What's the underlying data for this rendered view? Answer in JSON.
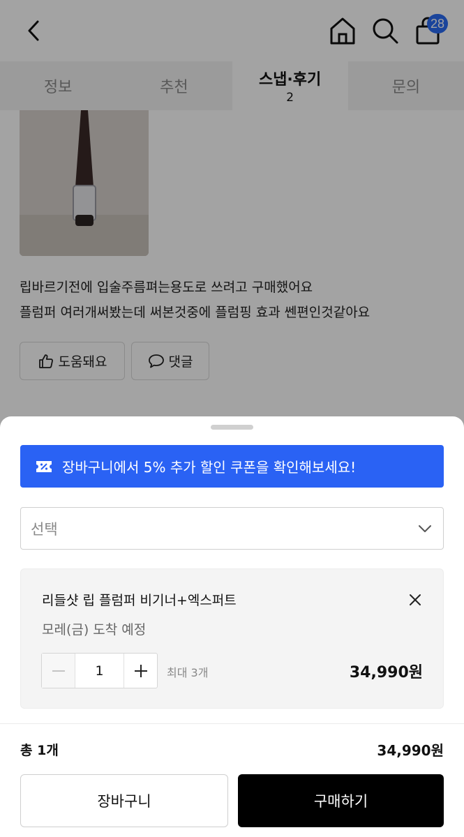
{
  "header": {
    "cart_count": "28"
  },
  "tabs": [
    {
      "label": "정보",
      "count": ""
    },
    {
      "label": "추천",
      "count": ""
    },
    {
      "label": "스냅·후기",
      "count": "2"
    },
    {
      "label": "문의",
      "count": ""
    }
  ],
  "review": {
    "line1": "립바르기전에 입술주름펴는용도로 쓰려고 구매했어요",
    "line2": "플럼퍼 여러개써봤는데 써본것중에 플럼핑 효과 쎈편인것같아요",
    "helpful_label": "도움돼요",
    "comment_label": "댓글"
  },
  "sheet": {
    "coupon_text": "장바구니에서 5% 추가 할인 쿠폰을 확인해보세요!",
    "select_placeholder": "선택",
    "option": {
      "title": "리들샷 립 플럼퍼 비기너+엑스퍼트",
      "delivery": "모레(금) 도착 예정",
      "quantity": "1",
      "max_note": "최대 3개",
      "price": "34,990원"
    },
    "total_label": "총 1개",
    "total_price": "34,990원",
    "cart_button": "장바구니",
    "buy_button": "구매하기"
  },
  "colors": {
    "accent_blue": "#2a62f4",
    "badge_blue": "#2a6bf2",
    "buy_button": "#000000"
  },
  "icons": [
    "back-arrow-icon",
    "home-icon",
    "search-icon",
    "shopping-bag-icon",
    "thumbs-up-icon",
    "speech-bubble-icon",
    "coupon-icon",
    "chevron-down-icon",
    "close-icon",
    "minus-icon",
    "plus-icon"
  ]
}
